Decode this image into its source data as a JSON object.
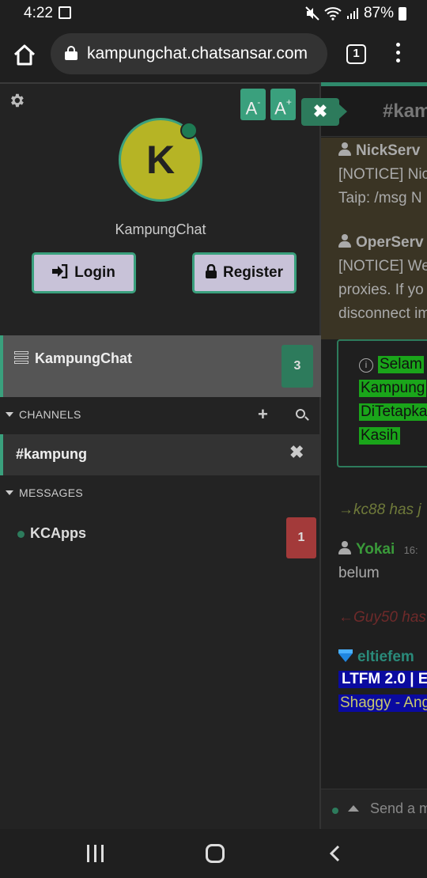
{
  "status_bar": {
    "time": "4:22",
    "battery": "87%"
  },
  "browser": {
    "url": "kampungchat.chatsansar.com",
    "tab_count": "1"
  },
  "chat": {
    "channel_title": "#kampung",
    "service_messages": [
      {
        "nick": "NickServ",
        "line1": "[NOTICE] Nic",
        "line2": "Taip: /msg N"
      },
      {
        "nick": "OperServ",
        "line1": "[NOTICE] We",
        "line2": "proxies. If yo",
        "line3": "disconnect im"
      }
    ],
    "welcome_lines": [
      "Selam",
      "Kampung",
      "DiTetapka",
      "Kasih"
    ],
    "join_line": "→kc88 has j",
    "user_msg": {
      "nick": "Yokai",
      "time": "16:",
      "text": "belum"
    },
    "part_line": "←Guy50 has",
    "eltiefem": {
      "nick": "eltiefem",
      "line1": "LTFM 2.0 | E",
      "line2": "Shaggy - Ang"
    },
    "input_placeholder": "Send a m"
  },
  "sidebar": {
    "font_smaller": "A",
    "font_larger": "A",
    "avatar_letter": "K",
    "username": "KampungChat",
    "login_label": "Login",
    "register_label": "Register",
    "network_name": "KampungChat",
    "network_badge": "3",
    "channels_header": "CHANNELS",
    "channel_name": "#kampung",
    "messages_header": "MESSAGES",
    "message_name": "KCApps",
    "message_badge": "1"
  },
  "colors": {
    "accent": "#3aa07d",
    "avatar": "#b6b425",
    "alert": "#a33a3a"
  }
}
